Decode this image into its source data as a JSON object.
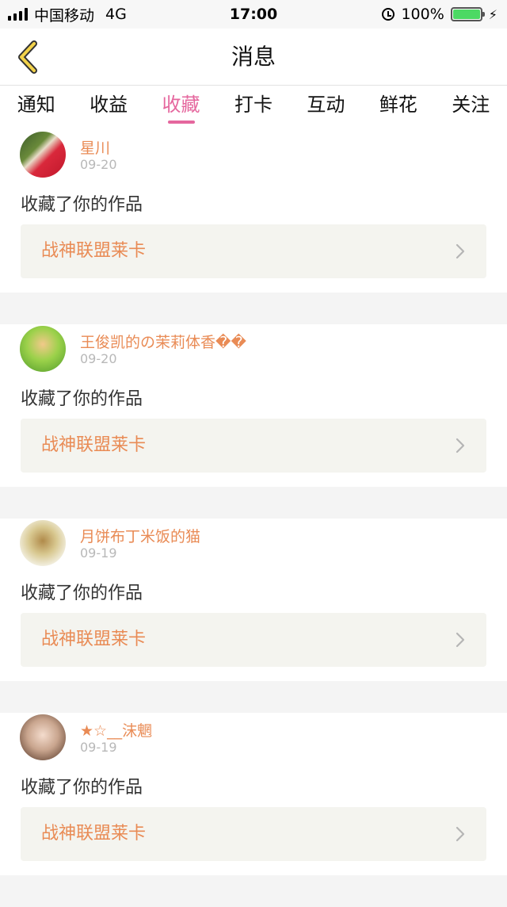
{
  "status_bar": {
    "carrier": "中国移动",
    "network": "4G",
    "time": "17:00",
    "battery": "100%",
    "battery_level": 1.0
  },
  "nav": {
    "back_icon": "chevron-left-icon",
    "title": "消息"
  },
  "tabs": [
    {
      "label": "通知"
    },
    {
      "label": "收益"
    },
    {
      "label": "收藏",
      "active": true
    },
    {
      "label": "打卡"
    },
    {
      "label": "互动"
    },
    {
      "label": "鲜花"
    },
    {
      "label": "关注"
    }
  ],
  "colors": {
    "accent_pink": "#e5679e",
    "username_orange": "#e98b55",
    "card_box": "#f4f4ef"
  },
  "messages": [
    {
      "username": "星川",
      "date": "09-20",
      "action": "收藏了你的作品",
      "work_title": "战神联盟莱卡"
    },
    {
      "username": "王俊凯的の茉莉体香��",
      "date": "09-20",
      "action": "收藏了你的作品",
      "work_title": "战神联盟莱卡"
    },
    {
      "username": "月饼布丁米饭的猫",
      "date": "09-19",
      "action": "收藏了你的作品",
      "work_title": "战神联盟莱卡"
    },
    {
      "username": "★☆__沫魍",
      "date": "09-19",
      "action": "收藏了你的作品",
      "work_title": "战神联盟莱卡"
    }
  ]
}
